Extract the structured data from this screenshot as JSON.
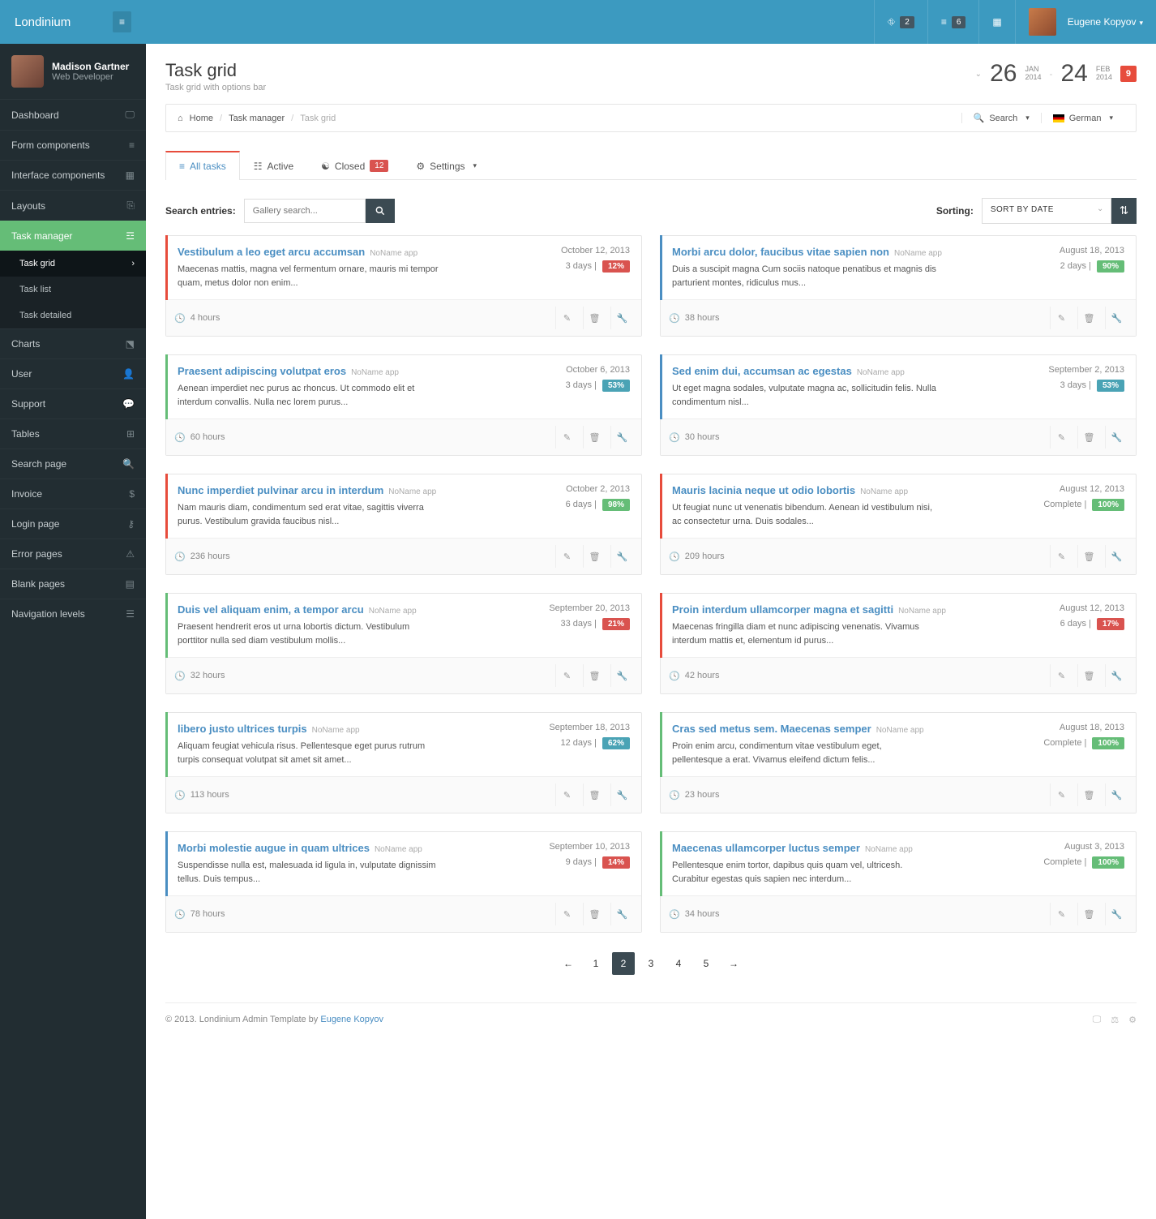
{
  "brand": "Londinium",
  "top": {
    "count1": "2",
    "count2": "6",
    "user": "Eugene Kopyov"
  },
  "profile": {
    "name": "Madison Gartner",
    "role": "Web Developer"
  },
  "nav": {
    "dashboard": "Dashboard",
    "form": "Form components",
    "interface": "Interface components",
    "layouts": "Layouts",
    "taskmgr": "Task manager",
    "sub_grid": "Task grid",
    "sub_list": "Task list",
    "sub_detail": "Task detailed",
    "charts": "Charts",
    "user": "User",
    "support": "Support",
    "tables": "Tables",
    "search": "Search page",
    "invoice": "Invoice",
    "login": "Login page",
    "error": "Error pages",
    "blank": "Blank pages",
    "navlev": "Navigation levels"
  },
  "page": {
    "title": "Task grid",
    "subtitle": "Task grid with options bar",
    "d1": "26",
    "m1a": "JAN",
    "m1b": "2014",
    "d2": "24",
    "m2a": "FEB",
    "m2b": "2014",
    "badge": "9"
  },
  "crumbs": {
    "home": "Home",
    "mgr": "Task manager",
    "cur": "Task grid",
    "search": "Search",
    "lang": "German"
  },
  "tabs": {
    "all": "All tasks",
    "active": "Active",
    "closed": "Closed",
    "closed_n": "12",
    "settings": "Settings"
  },
  "filters": {
    "search_label": "Search entries:",
    "search_ph": "Gallery search...",
    "sort_label": "Sorting:",
    "sort_value": "SORT BY DATE"
  },
  "left": [
    {
      "c": "red",
      "title": "Vestibulum a leo eget arcu accumsan",
      "app": "NoName app",
      "date": "October 12, 2013",
      "desc": "Maecenas mattis, magna vel fermentum ornare, mauris mi tempor quam, metus dolor non enim...",
      "days": "3 days",
      "pct": "12%",
      "pc": "red",
      "hours": "4 hours"
    },
    {
      "c": "green",
      "title": "Praesent adipiscing volutpat eros",
      "app": "NoName app",
      "date": "October 6, 2013",
      "desc": "Aenean imperdiet nec purus ac rhoncus. Ut commodo elit et interdum convallis. Nulla nec lorem purus...",
      "days": "3 days",
      "pct": "53%",
      "pc": "teal",
      "hours": "60 hours"
    },
    {
      "c": "red",
      "title": "Nunc imperdiet pulvinar arcu in interdum",
      "app": "NoName app",
      "date": "October 2, 2013",
      "desc": "Nam mauris diam, condimentum sed erat vitae, sagittis viverra purus. Vestibulum gravida faucibus nisl...",
      "days": "6 days",
      "pct": "98%",
      "pc": "green",
      "hours": "236 hours"
    },
    {
      "c": "green",
      "title": "Duis vel aliquam enim, a tempor arcu",
      "app": "NoName app",
      "date": "September 20, 2013",
      "desc": "Praesent hendrerit eros ut urna lobortis dictum. Vestibulum porttitor nulla sed diam vestibulum mollis...",
      "days": "33 days",
      "pct": "21%",
      "pc": "red",
      "hours": "32 hours"
    },
    {
      "c": "green",
      "title": "libero justo ultrices turpis",
      "app": "NoName app",
      "date": "September 18, 2013",
      "desc": "Aliquam feugiat vehicula risus. Pellentesque eget purus rutrum turpis consequat volutpat sit amet sit amet...",
      "days": "12 days",
      "pct": "62%",
      "pc": "teal",
      "hours": "113 hours"
    },
    {
      "c": "blue",
      "title": "Morbi molestie augue in quam ultrices",
      "app": "NoName app",
      "date": "September 10, 2013",
      "desc": "Suspendisse nulla est, malesuada id ligula in, vulputate dignissim tellus. Duis tempus...",
      "days": "9 days",
      "pct": "14%",
      "pc": "red",
      "hours": "78 hours"
    }
  ],
  "right": [
    {
      "c": "blue",
      "title": "Morbi arcu dolor, faucibus vitae sapien non",
      "app": "NoName app",
      "date": "August 18, 2013",
      "desc": "Duis a suscipit magna Cum sociis natoque penatibus et magnis dis parturient montes, ridiculus mus...",
      "days": "2 days",
      "pct": "90%",
      "pc": "green",
      "hours": "38 hours"
    },
    {
      "c": "blue",
      "title": "Sed enim dui, accumsan ac egestas",
      "app": "NoName app",
      "date": "September 2, 2013",
      "desc": "Ut eget magna sodales, vulputate magna ac, sollicitudin felis. Nulla condimentum nisl...",
      "days": "3 days",
      "pct": "53%",
      "pc": "teal",
      "hours": "30 hours"
    },
    {
      "c": "red",
      "title": "Mauris lacinia neque ut odio lobortis",
      "app": "NoName app",
      "date": "August 12, 2013",
      "desc": "Ut feugiat nunc ut venenatis bibendum. Aenean id vestibulum nisi, ac consectetur urna. Duis sodales...",
      "days": "Complete",
      "pct": "100%",
      "pc": "green",
      "hours": "209 hours"
    },
    {
      "c": "red",
      "title": "Proin interdum ullamcorper magna et sagitti",
      "app": "NoName app",
      "date": "August 12, 2013",
      "desc": "Maecenas fringilla diam et nunc adipiscing venenatis. Vivamus interdum mattis et, elementum id purus...",
      "days": "6 days",
      "pct": "17%",
      "pc": "red",
      "hours": "42 hours"
    },
    {
      "c": "green",
      "title": "Cras sed metus sem. Maecenas semper",
      "app": "NoName app",
      "date": "August 18, 2013",
      "desc": "Proin enim arcu, condimentum vitae vestibulum eget, pellentesque a erat. Vivamus eleifend dictum felis...",
      "days": "Complete",
      "pct": "100%",
      "pc": "green",
      "hours": "23 hours"
    },
    {
      "c": "green",
      "title": "Maecenas ullamcorper luctus semper",
      "app": "NoName app",
      "date": "August 3, 2013",
      "desc": "Pellentesque enim tortor, dapibus quis quam vel, ultricesh. Curabitur egestas quis sapien nec interdum...",
      "days": "Complete",
      "pct": "100%",
      "pc": "green",
      "hours": "34 hours"
    }
  ],
  "pager": [
    "1",
    "2",
    "3",
    "4",
    "5"
  ],
  "footer": {
    "text": "© 2013. Londinium Admin Template by ",
    "author": "Eugene Kopyov"
  }
}
